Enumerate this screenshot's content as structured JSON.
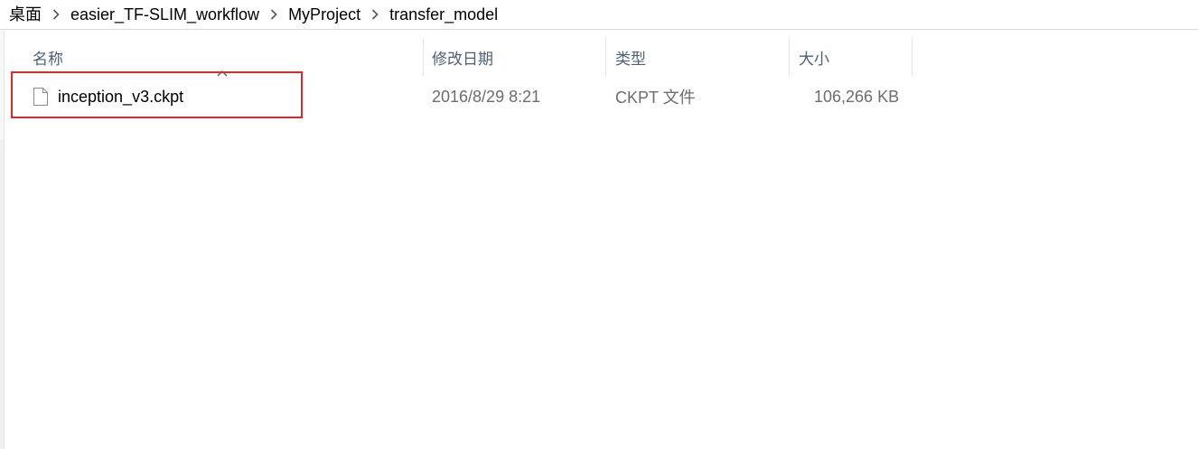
{
  "breadcrumb": {
    "items": [
      "桌面",
      "easier_TF-SLIM_workflow",
      "MyProject",
      "transfer_model"
    ],
    "separator_icon": "chevron-right-icon"
  },
  "columns": {
    "name": "名称",
    "modified": "修改日期",
    "type": "类型",
    "size": "大小",
    "sort_icon": "sort-ascending-icon"
  },
  "files": [
    {
      "name": "inception_v3.ckpt",
      "modified": "2016/8/29 8:21",
      "type": "CKPT 文件",
      "size": "106,266 KB",
      "icon": "file-icon"
    }
  ],
  "colors": {
    "header_text": "#4c607a",
    "detail_text": "#6d6d6d",
    "highlight_border": "#e3262e"
  }
}
